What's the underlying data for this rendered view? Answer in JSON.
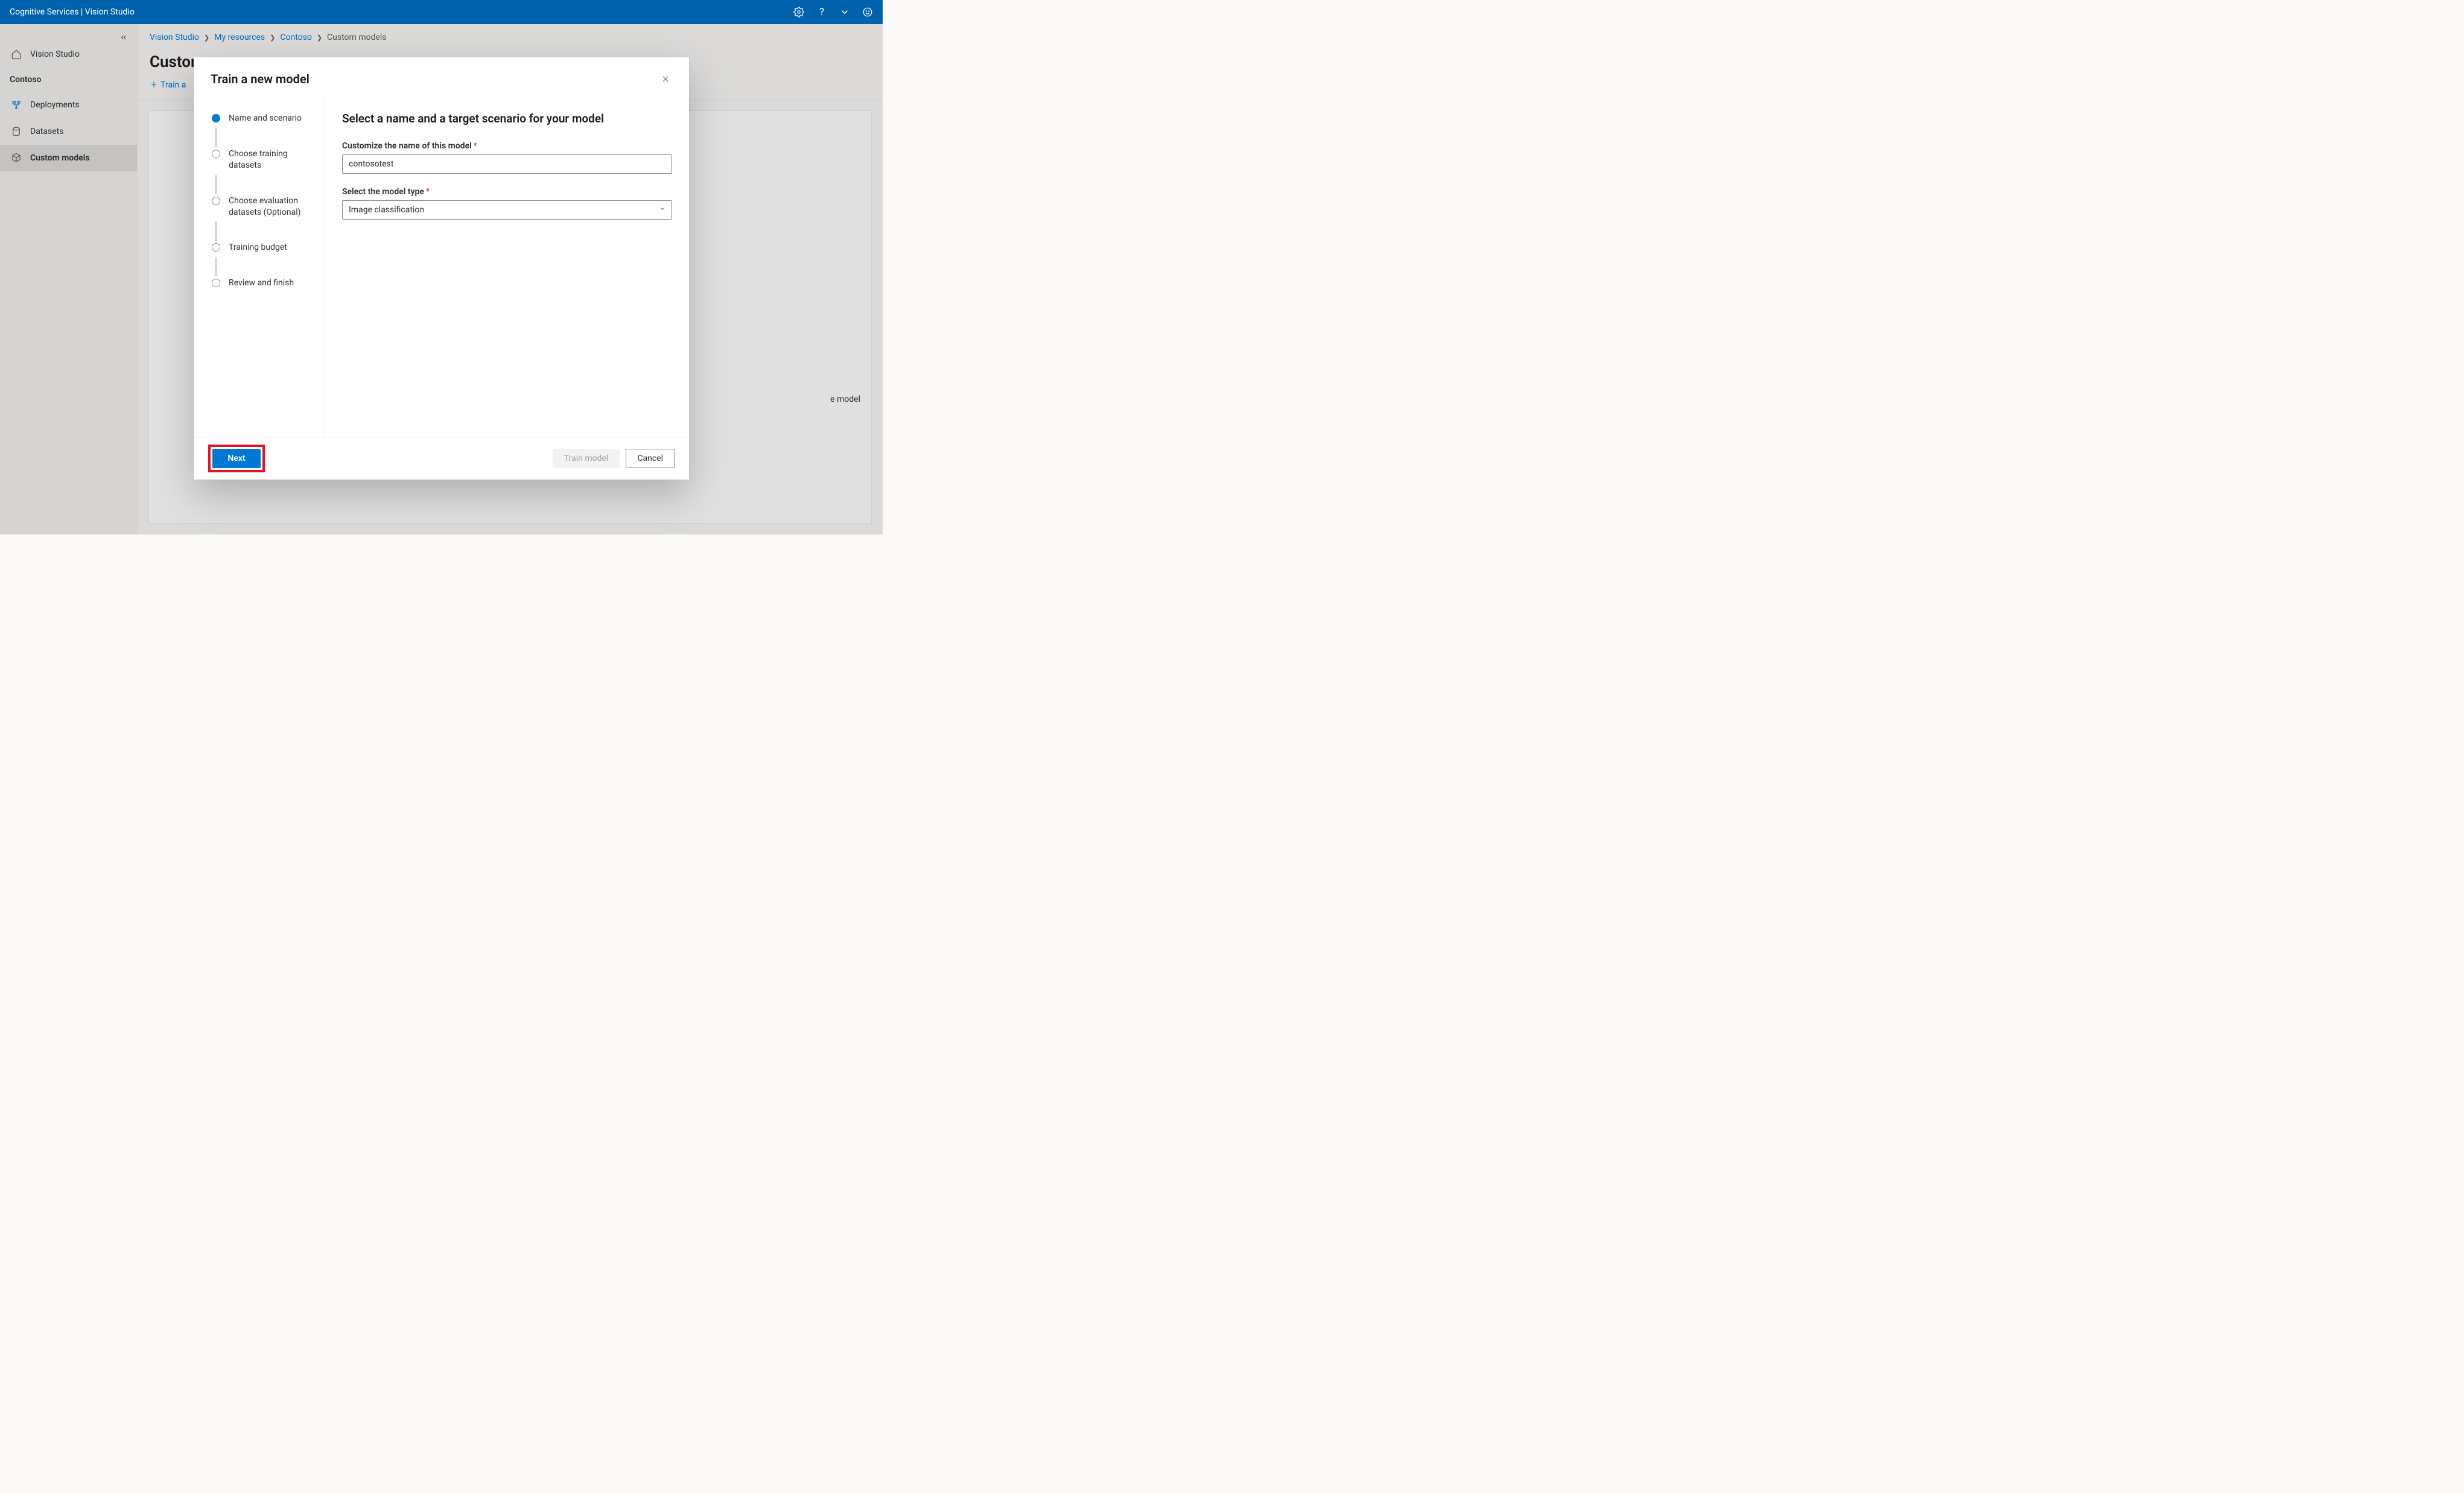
{
  "header": {
    "title": "Cognitive Services  |  Vision Studio"
  },
  "sidebar": {
    "home_label": "Vision Studio",
    "resource_label": "Contoso",
    "items": [
      {
        "label": "Deployments"
      },
      {
        "label": "Datasets"
      },
      {
        "label": "Custom models"
      }
    ]
  },
  "breadcrumbs": {
    "items": [
      "Vision Studio",
      "My resources",
      "Contoso",
      "Custom models"
    ]
  },
  "page": {
    "title_prefix": "Custom",
    "toolbar_train_prefix": "Train a",
    "bg_hint_suffix": "e model"
  },
  "modal": {
    "title": "Train a new model",
    "steps": [
      {
        "label": "Name and scenario"
      },
      {
        "label": "Choose training datasets"
      },
      {
        "label": "Choose evaluation datasets (Optional)"
      },
      {
        "label": "Training budget"
      },
      {
        "label": "Review and finish"
      }
    ],
    "pane": {
      "heading": "Select a name and a target scenario for your model",
      "name_field_label": "Customize the name of this model",
      "name_value": "contosotest",
      "type_field_label": "Select the model type",
      "type_value": "Image classification"
    },
    "footer": {
      "next": "Next",
      "train": "Train model",
      "cancel": "Cancel"
    }
  }
}
